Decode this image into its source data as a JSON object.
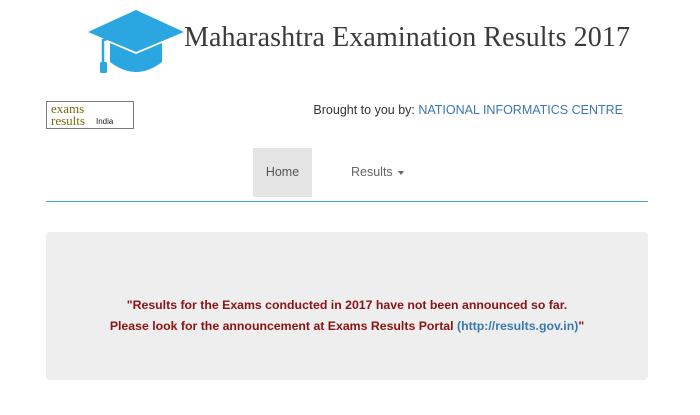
{
  "header": {
    "title": "Maharashtra Examination Results 2017",
    "icon": "graduation-cap-icon",
    "icon_color": "#2aa6e0"
  },
  "logo": {
    "line1": "exams",
    "line2": "results",
    "line3": "India"
  },
  "credit": {
    "prefix": "Brought to you by: ",
    "org": "NATIONAL INFORMATICS CENTRE"
  },
  "nav": {
    "home": "Home",
    "results": "Results"
  },
  "alert": {
    "line1": "\"Results for the Exams conducted in 2017 have not been announced so far.",
    "line2_prefix": "Please look for the announcement at Exams Results Portal ",
    "link": "(http://results.gov.in)",
    "line2_suffix": "\""
  },
  "colors": {
    "accent_line": "#4aa6c9",
    "message": "#8b1212",
    "link": "#3a78b0"
  }
}
